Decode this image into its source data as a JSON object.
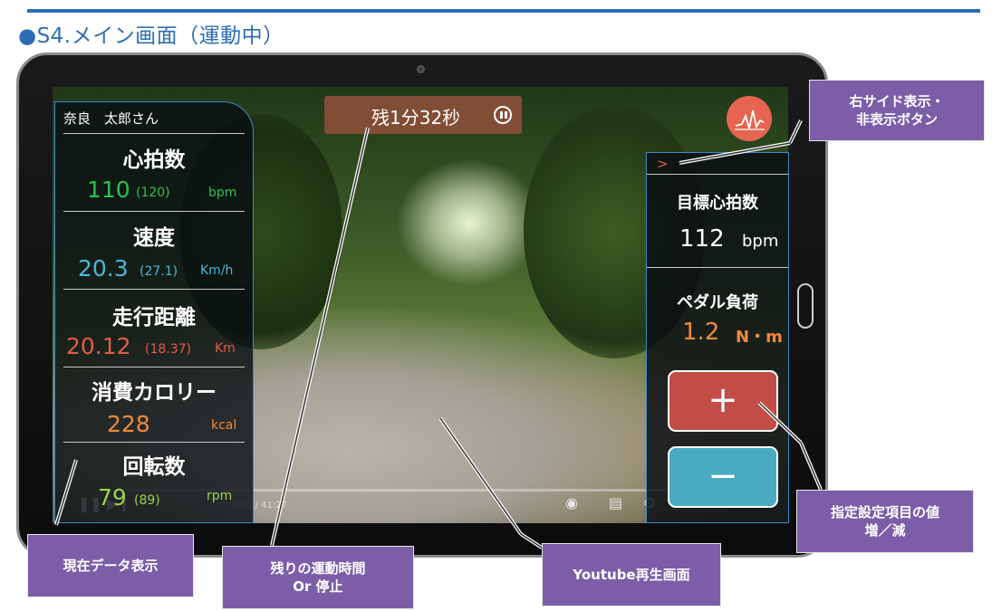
{
  "heading": "●S4.メイン画面（運動中）",
  "user": {
    "name": "奈良　太郎さん"
  },
  "metrics": {
    "heart_rate": {
      "title": "心拍数",
      "value": "110",
      "sub": "(120)",
      "unit": "bpm",
      "color": "#2fbf4f"
    },
    "speed": {
      "title": "速度",
      "value": "20.3",
      "sub": "(27.1)",
      "unit": "Km/h",
      "color": "#49b6d8"
    },
    "distance": {
      "title": "走行距離",
      "value": "20.12",
      "sub": "(18.37)",
      "unit": "Km",
      "color": "#e35b4a"
    },
    "calories": {
      "title": "消費カロリー",
      "value": "228",
      "unit": "kcal",
      "color": "#f08a3c"
    },
    "rpm": {
      "title": "回転数",
      "value": "79",
      "sub": "(89)",
      "unit": "rpm",
      "color": "#9bd24a"
    }
  },
  "timer": {
    "text": "残1分32秒"
  },
  "player": {
    "time": "3:50 / 41:27"
  },
  "right_panel": {
    "toggle": ">",
    "target_hr": {
      "title": "目標心拍数",
      "value": "112",
      "unit": "bpm"
    },
    "pedal_load": {
      "title": "ペダル負荷",
      "value": "1.2",
      "unit": "N・m",
      "color": "#f08a3c"
    },
    "plus_label": "+",
    "minus_label": "−"
  },
  "callouts": {
    "right_side": "右サイド表示・\n非表示ボタン",
    "inc_dec": "指定設定項目の値\n増／減",
    "current_data": "現在データ表示",
    "remaining": "残りの運動時間\nOr 停止",
    "youtube": "Youtube再生画面"
  }
}
